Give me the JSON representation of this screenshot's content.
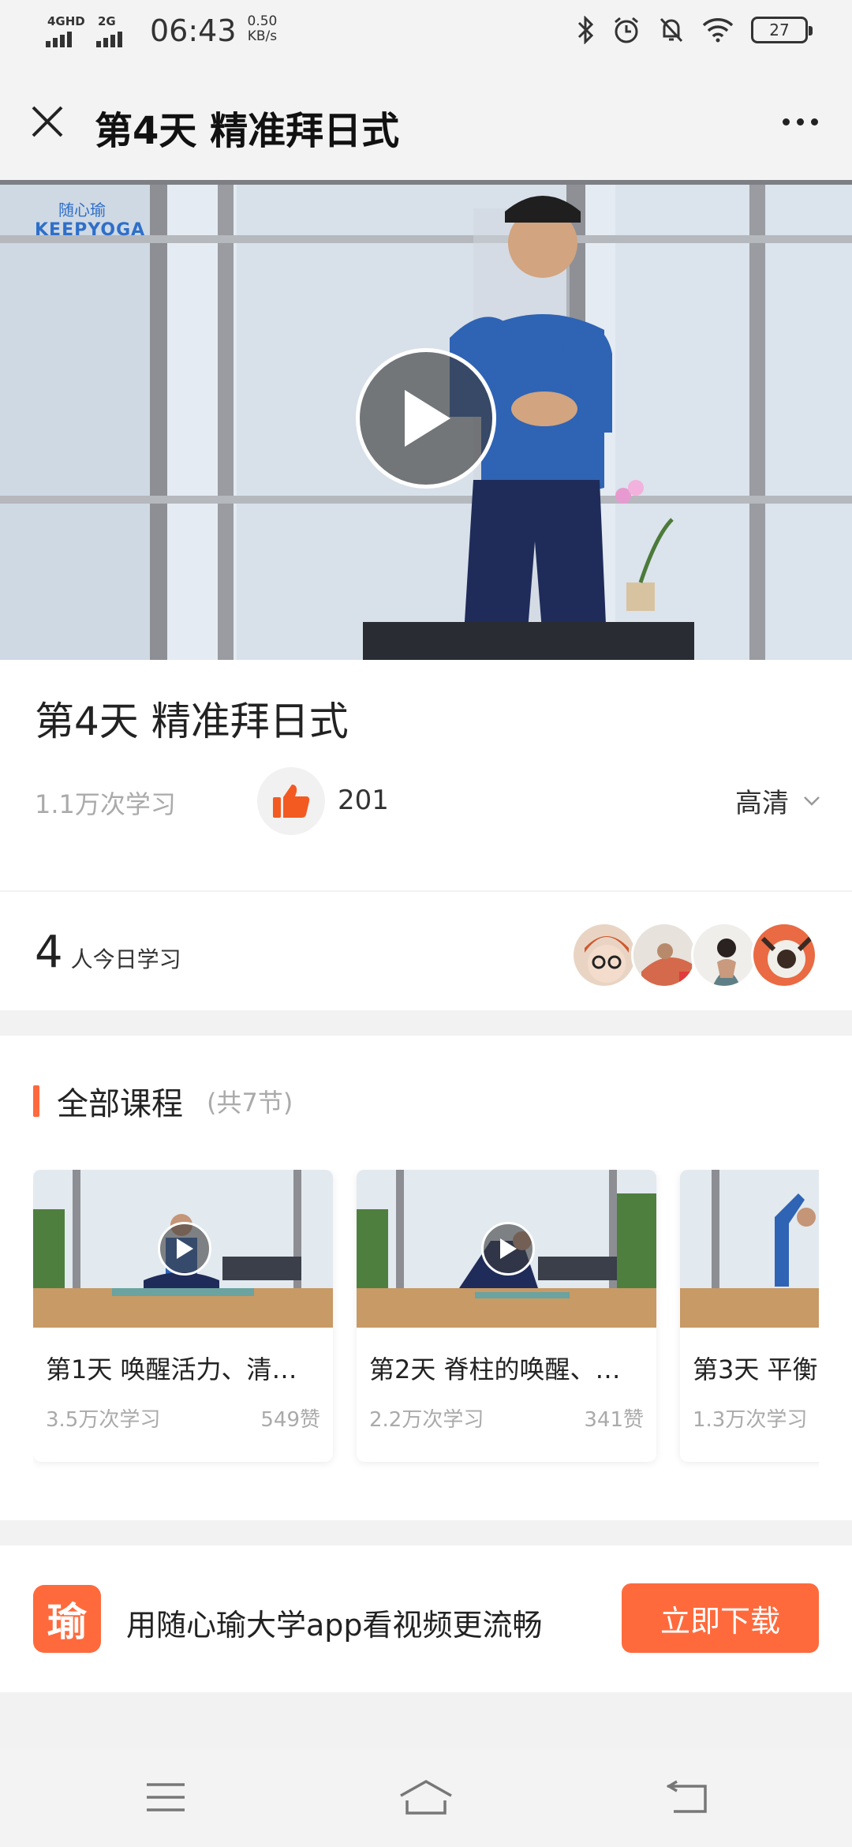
{
  "status_bar": {
    "network1": "4GHD",
    "network2": "2G",
    "time": "06:43",
    "speed_value": "0.50",
    "speed_unit": "KB/s",
    "battery": "27",
    "icons": [
      "bluetooth-icon",
      "alarm-icon",
      "mute-icon",
      "wifi-icon",
      "battery-icon"
    ]
  },
  "header": {
    "title": "第4天 精准拜日式"
  },
  "video": {
    "watermark_line1": "随心瑜",
    "watermark_line2": "KEEPYOGA"
  },
  "lesson": {
    "title": "第4天 精准拜日式",
    "views": "1.1万次学习",
    "likes": "201",
    "quality": "高清"
  },
  "learners": {
    "count": "4",
    "label": "人今日学习"
  },
  "courses": {
    "section_title": "全部课程",
    "count_label": "(共7节)",
    "items": [
      {
        "title": "第1天 唤醒活力、清…",
        "views": "3.5万次学习",
        "likes": "549赞"
      },
      {
        "title": "第2天 脊柱的唤醒、…",
        "views": "2.2万次学习",
        "likes": "341赞"
      },
      {
        "title": "第3天 平衡",
        "views": "1.3万次学习",
        "likes": ""
      }
    ]
  },
  "download": {
    "logo_char": "瑜",
    "text": "用随心瑜大学app看视频更流畅",
    "button": "立即下载"
  },
  "colors": {
    "accent": "#ff6a3d",
    "like_orange": "#f25a22"
  }
}
